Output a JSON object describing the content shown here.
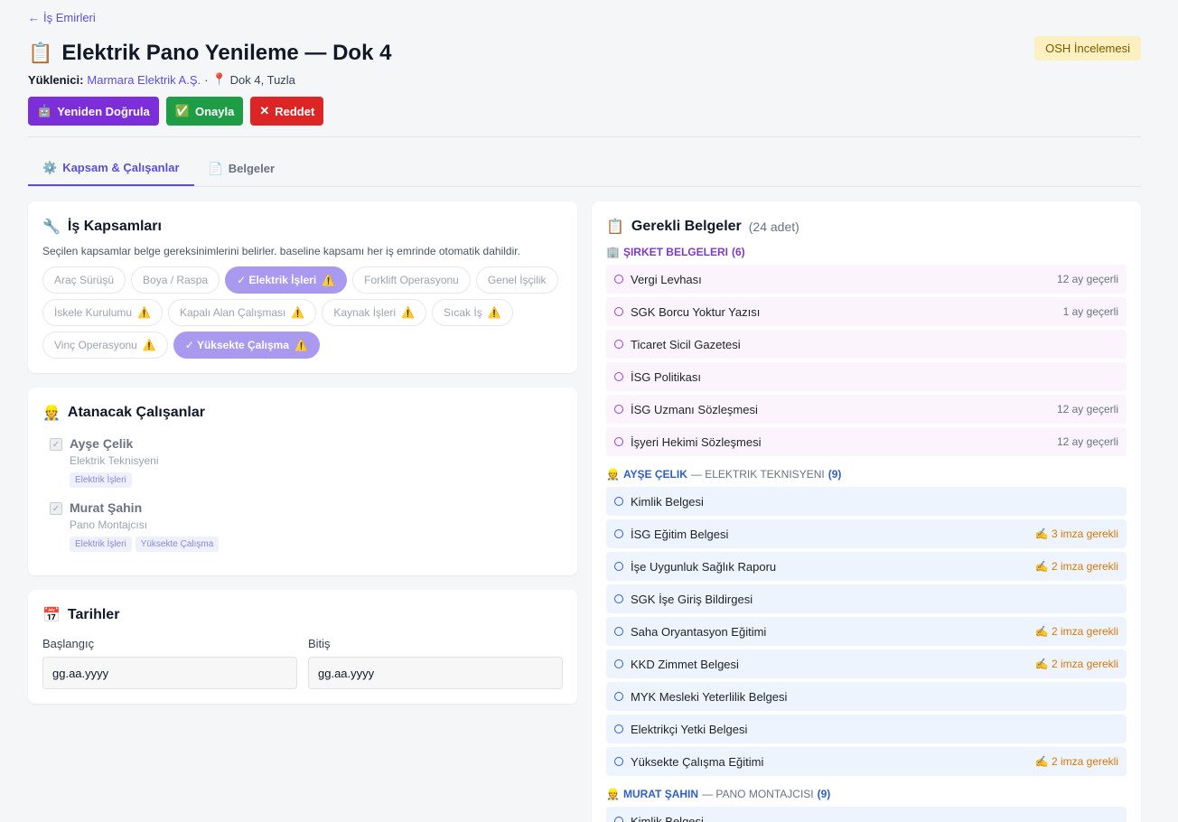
{
  "back": {
    "arrow": "←",
    "label": "İş Emirleri"
  },
  "header": {
    "icon": "📋",
    "title": "Elektrik Pano Yenileme — Dok 4",
    "badge": "OSH İncelemesi",
    "contractor_label": "Yüklenici:",
    "contractor": "Marmara Elektrik A.Ş.",
    "separator": "·",
    "location_icon": "📍",
    "location": "Dok 4, Tuzla"
  },
  "actions": {
    "reverify": {
      "icon": "🤖",
      "label": "Yeniden Doğrula"
    },
    "approve": {
      "icon": "✅",
      "label": "Onayla"
    },
    "reject": {
      "icon": "✕",
      "label": "Reddet"
    }
  },
  "tabs": [
    {
      "icon": "⚙️",
      "label": "Kapsam & Çalışanlar",
      "active": true
    },
    {
      "icon": "📄",
      "label": "Belgeler",
      "active": false
    }
  ],
  "scopes": {
    "icon": "🔧",
    "title": "İş Kapsamları",
    "description": "Seçilen kapsamlar belge gereksinimlerini belirler. baseline kapsamı her iş emrinde otomatik dahildir.",
    "warn_icon": "⚠️",
    "items": [
      {
        "label": "Araç Sürüşü",
        "selected": false,
        "warn": false
      },
      {
        "label": "Boya / Raspa",
        "selected": false,
        "warn": false
      },
      {
        "label": "✓ Elektrik İşleri",
        "selected": true,
        "warn": true
      },
      {
        "label": "Forklift Operasyonu",
        "selected": false,
        "warn": false
      },
      {
        "label": "Genel İşçilik",
        "selected": false,
        "warn": false
      },
      {
        "label": "İskele Kurulumu",
        "selected": false,
        "warn": true
      },
      {
        "label": "Kapalı Alan Çalışması",
        "selected": false,
        "warn": true
      },
      {
        "label": "Kaynak İşleri",
        "selected": false,
        "warn": true
      },
      {
        "label": "Sıcak İş",
        "selected": false,
        "warn": true
      },
      {
        "label": "Vinç Operasyonu",
        "selected": false,
        "warn": true
      },
      {
        "label": "✓ Yüksekte Çalışma",
        "selected": true,
        "warn": true
      }
    ]
  },
  "employees": {
    "icon": "👷",
    "title": "Atanacak Çalışanlar",
    "check_mark": "✓",
    "items": [
      {
        "name": "Ayşe Çelik",
        "role": "Elektrik Teknisyeni",
        "tags": [
          "Elektrik İşleri"
        ]
      },
      {
        "name": "Murat Şahin",
        "role": "Pano Montajcısı",
        "tags": [
          "Elektrik İşleri",
          "Yüksekte Çalışma"
        ]
      }
    ]
  },
  "dates": {
    "icon": "📅",
    "title": "Tarihler",
    "start_label": "Başlangıç",
    "start_value": "gg.aa.yyyy",
    "end_label": "Bitiş",
    "end_value": "gg.aa.yyyy"
  },
  "required_docs": {
    "icon": "📋",
    "title": "Gerekli Belgeler",
    "count": "(24 adet)",
    "company_section": {
      "icon": "🏢",
      "label": "ŞIRKET BELGELERI",
      "count": "(6)",
      "docs": [
        {
          "name": "Vergi Levhası",
          "note": "12 ay geçerli"
        },
        {
          "name": "SGK Borcu Yoktur Yazısı",
          "note": "1 ay geçerli"
        },
        {
          "name": "Ticaret Sicil Gazetesi",
          "note": ""
        },
        {
          "name": "İSG Politikası",
          "note": ""
        },
        {
          "name": "İSG Uzmanı Sözleşmesi",
          "note": "12 ay geçerli"
        },
        {
          "name": "İşyeri Hekimi Sözleşmesi",
          "note": "12 ay geçerli"
        }
      ]
    },
    "employee_sections": [
      {
        "icon": "👷",
        "name": "AYŞE ÇELIK",
        "role": "— ELEKTRIK TEKNISYENI",
        "count": "(9)",
        "docs": [
          {
            "name": "Kimlik Belgesi",
            "note": ""
          },
          {
            "name": "İSG Eğitim Belgesi",
            "note": "✍️ 3 imza gerekli"
          },
          {
            "name": "İşe Uygunluk Sağlık Raporu",
            "note": "✍️ 2 imza gerekli"
          },
          {
            "name": "SGK İşe Giriş Bildirgesi",
            "note": ""
          },
          {
            "name": "Saha Oryantasyon Eğitimi",
            "note": "✍️ 2 imza gerekli"
          },
          {
            "name": "KKD Zimmet Belgesi",
            "note": "✍️ 2 imza gerekli"
          },
          {
            "name": "MYK Mesleki Yeterlilik Belgesi",
            "note": ""
          },
          {
            "name": "Elektrikçi Yetki Belgesi",
            "note": ""
          },
          {
            "name": "Yüksekte Çalışma Eğitimi",
            "note": "✍️ 2 imza gerekli"
          }
        ]
      },
      {
        "icon": "👷",
        "name": "MURAT ŞAHIN",
        "role": "— PANO MONTAJCISI",
        "count": "(9)",
        "docs": [
          {
            "name": "Kimlik Belgesi",
            "note": ""
          }
        ]
      }
    ]
  }
}
